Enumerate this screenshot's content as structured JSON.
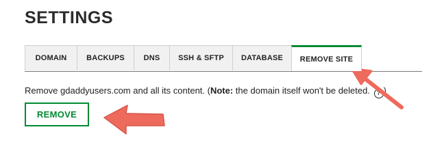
{
  "page": {
    "title": "SETTINGS"
  },
  "tabs": [
    {
      "label": "DOMAIN",
      "active": false
    },
    {
      "label": "BACKUPS",
      "active": false
    },
    {
      "label": "DNS",
      "active": false
    },
    {
      "label": "SSH & SFTP",
      "active": false
    },
    {
      "label": "DATABASE",
      "active": false
    },
    {
      "label": "REMOVE SITE",
      "active": true
    }
  ],
  "remove_site": {
    "desc_prefix": "Remove gdaddyusers.com and all its content. (",
    "note_label": "Note:",
    "note_text": " the domain itself won't be deleted.",
    "desc_suffix": ")",
    "help_glyph": "?",
    "button_label": "REMOVE"
  },
  "colors": {
    "accent": "#008a32",
    "annotation_arrow": "#ee6a5c"
  },
  "icons": {
    "help": "question-circle-icon"
  }
}
